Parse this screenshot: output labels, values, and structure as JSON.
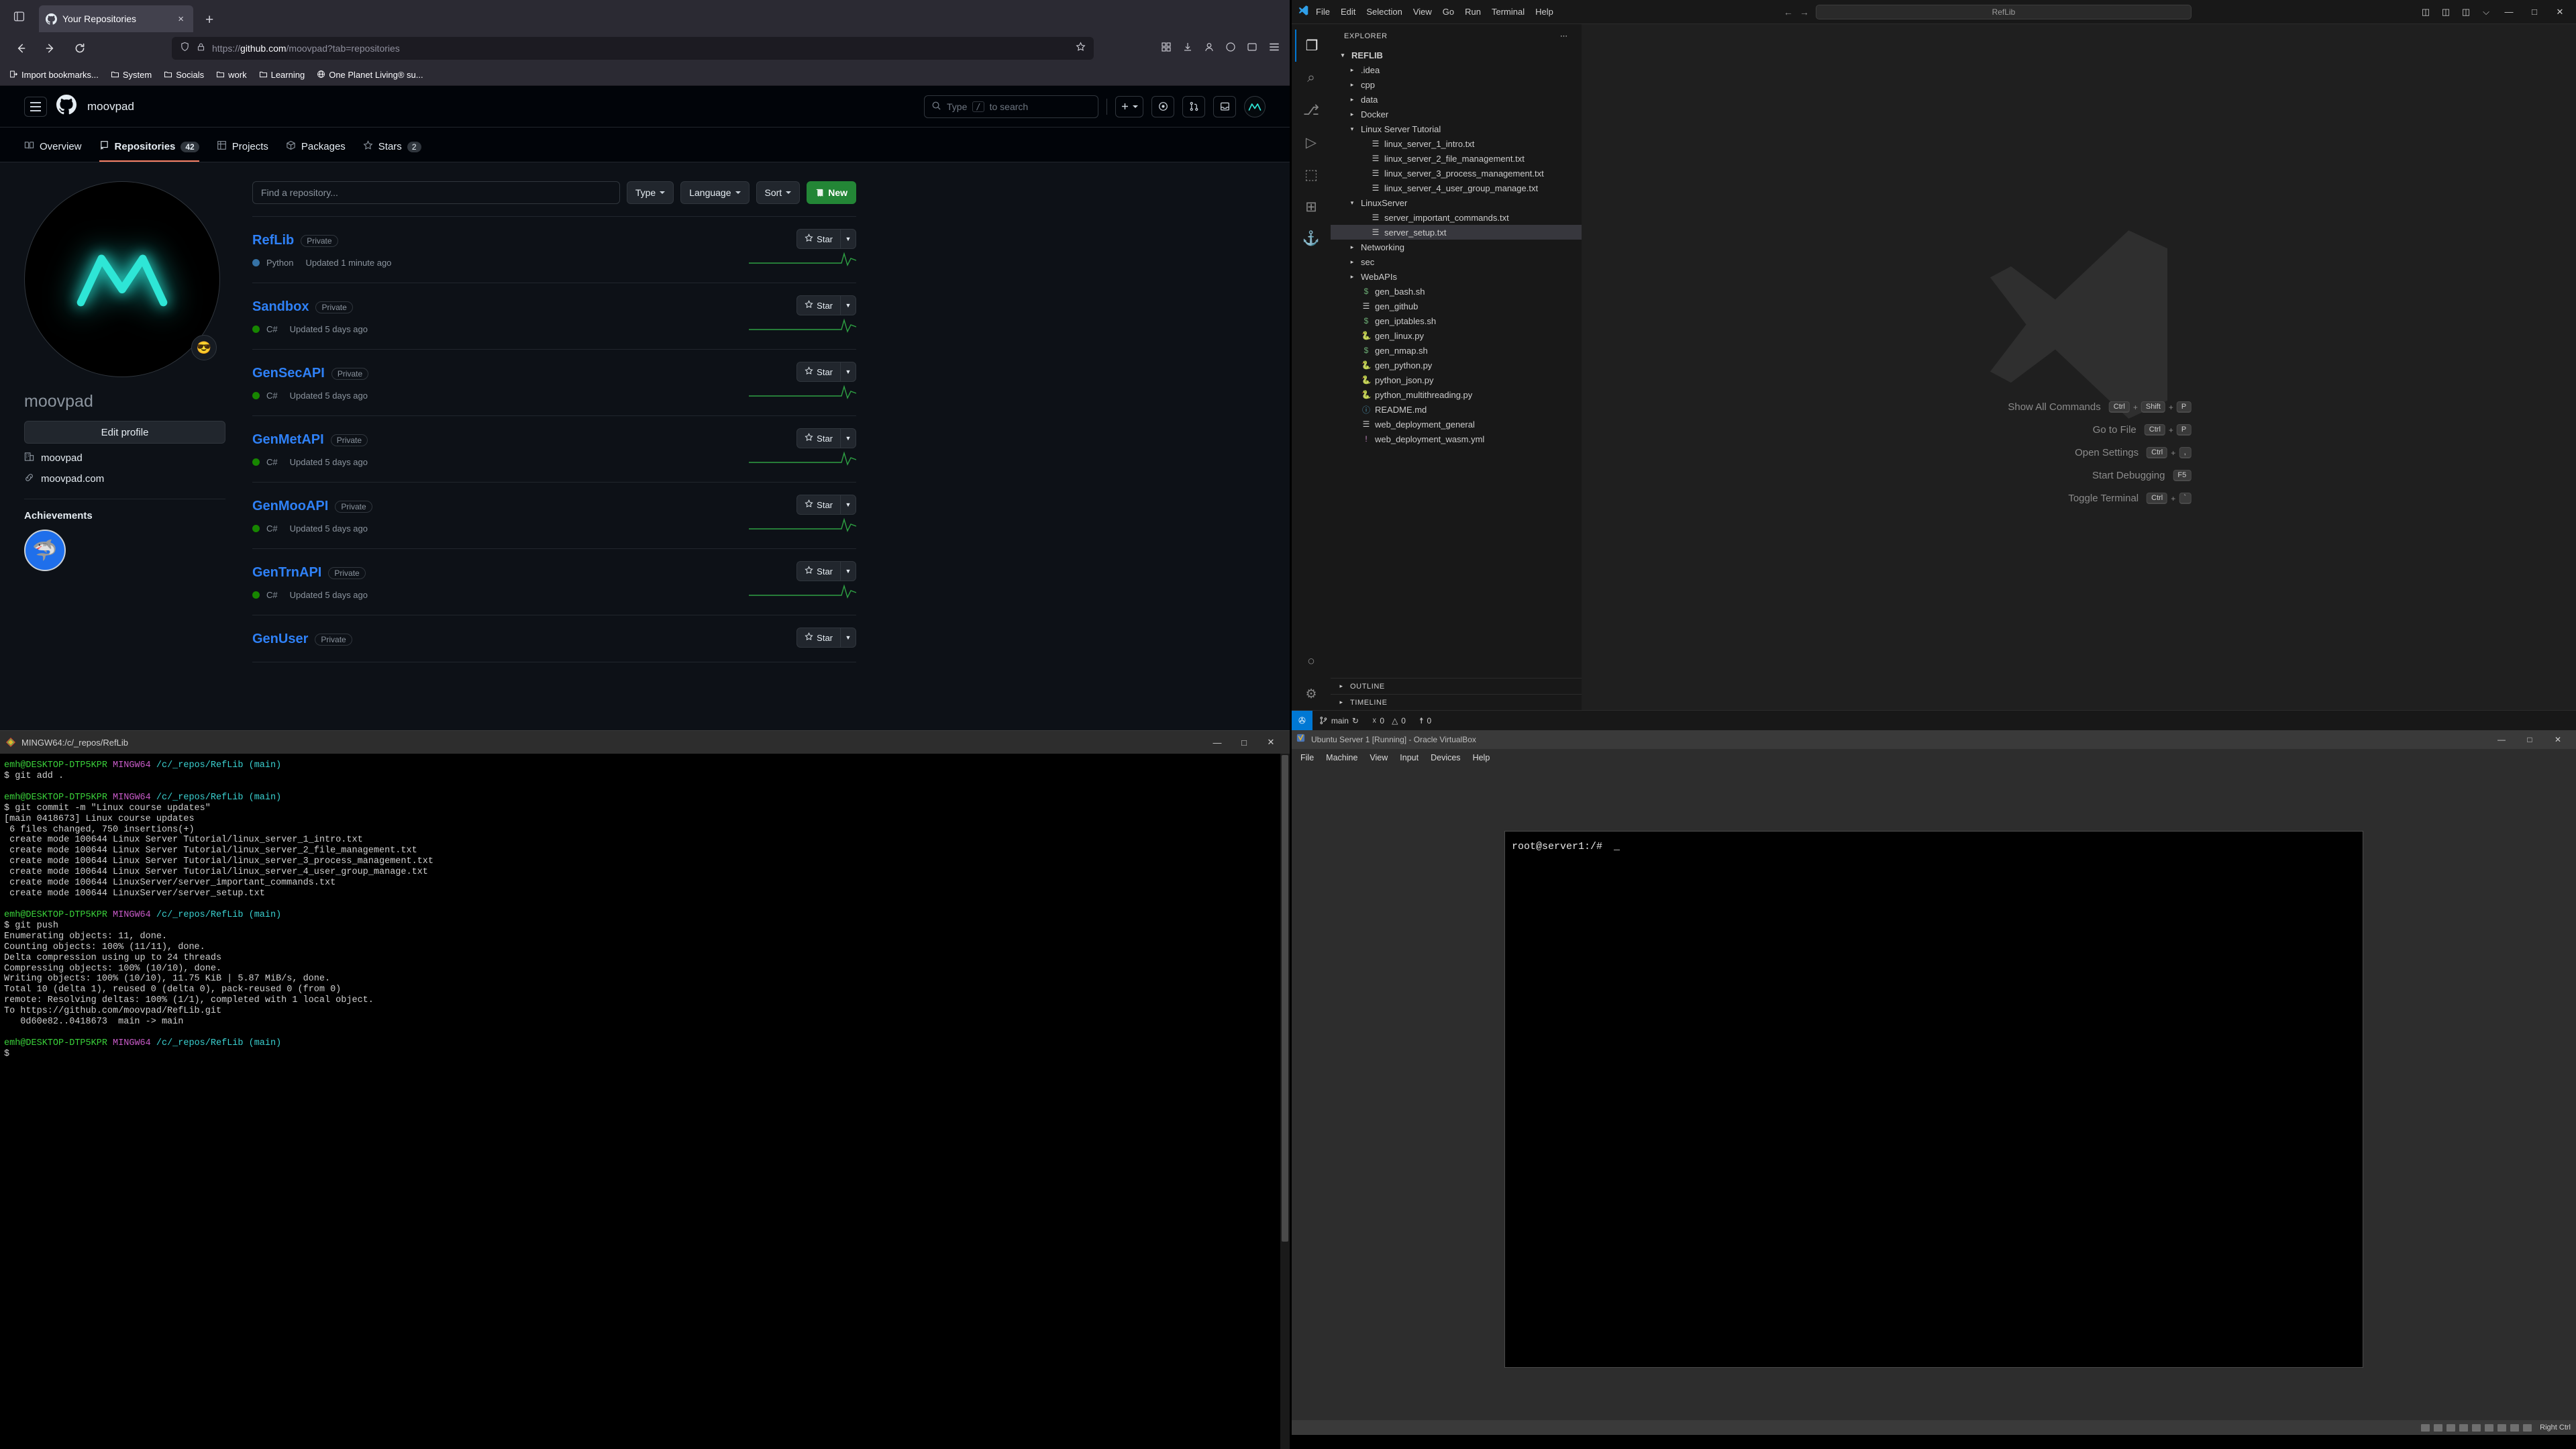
{
  "firefox": {
    "tab": {
      "title": "Your Repositories",
      "favicon": "github-icon"
    },
    "newtab_label": "+",
    "close_label": "×",
    "url": {
      "scheme": "https://",
      "domain": "github.com",
      "path": "/moovpad?tab=repositories"
    },
    "bookmarks": [
      {
        "label": "Import bookmarks...",
        "icon": "import-icon"
      },
      {
        "label": "System",
        "icon": "folder-icon"
      },
      {
        "label": "Socials",
        "icon": "folder-icon"
      },
      {
        "label": "work",
        "icon": "folder-icon"
      },
      {
        "label": "Learning",
        "icon": "folder-icon"
      },
      {
        "label": "One Planet Living® su...",
        "icon": "globe-icon"
      }
    ]
  },
  "github": {
    "owner": "moovpad",
    "search_placeholder": "Type",
    "search_kbd": "/",
    "search_suffix": "to search",
    "tabs": [
      {
        "label": "Overview",
        "icon": "book-icon",
        "count": null,
        "active": false
      },
      {
        "label": "Repositories",
        "icon": "repo-icon",
        "count": "42",
        "active": true
      },
      {
        "label": "Projects",
        "icon": "table-icon",
        "count": null,
        "active": false
      },
      {
        "label": "Packages",
        "icon": "package-icon",
        "count": null,
        "active": false
      },
      {
        "label": "Stars",
        "icon": "star-icon",
        "count": "2",
        "active": false
      }
    ],
    "sidebar": {
      "avatar_alt": "moovpad neon M logo",
      "status_emoji": "😎",
      "username": "moovpad",
      "edit_profile_label": "Edit profile",
      "org": "moovpad",
      "website": "moovpad.com",
      "achievements_title": "Achievements",
      "achievement_badge": "🦈"
    },
    "filters": {
      "find_placeholder": "Find a repository...",
      "type_label": "Type",
      "language_label": "Language",
      "sort_label": "Sort",
      "new_label": "New"
    },
    "star_label": "Star",
    "repos": [
      {
        "name": "RefLib",
        "visibility": "Private",
        "language": "Python",
        "lang_color": "#3572A5",
        "updated": "Updated 1 minute ago"
      },
      {
        "name": "Sandbox",
        "visibility": "Private",
        "language": "C#",
        "lang_color": "#178600",
        "updated": "Updated 5 days ago"
      },
      {
        "name": "GenSecAPI",
        "visibility": "Private",
        "language": "C#",
        "lang_color": "#178600",
        "updated": "Updated 5 days ago"
      },
      {
        "name": "GenMetAPI",
        "visibility": "Private",
        "language": "C#",
        "lang_color": "#178600",
        "updated": "Updated 5 days ago"
      },
      {
        "name": "GenMooAPI",
        "visibility": "Private",
        "language": "C#",
        "lang_color": "#178600",
        "updated": "Updated 5 days ago"
      },
      {
        "name": "GenTrnAPI",
        "visibility": "Private",
        "language": "C#",
        "lang_color": "#178600",
        "updated": "Updated 5 days ago"
      },
      {
        "name": "GenUser",
        "visibility": "Private",
        "language": "",
        "lang_color": "#178600",
        "updated": ""
      }
    ]
  },
  "gitbash": {
    "title": "MINGW64:/c/_repos/RefLib",
    "minimize": "—",
    "maximize": "□",
    "close": "✕",
    "prompt_user": "emh@DESKTOP-DTP5KPR",
    "prompt_host": "MINGW64",
    "prompt_path": "/c/_repos/RefLib",
    "prompt_branch": "(main)",
    "blocks": [
      {
        "command": "$ git add .",
        "output": []
      },
      {
        "command": "$ git commit -m \"Linux course updates\"",
        "output": [
          "[main 0418673] Linux course updates",
          " 6 files changed, 750 insertions(+)",
          " create mode 100644 Linux Server Tutorial/linux_server_1_intro.txt",
          " create mode 100644 Linux Server Tutorial/linux_server_2_file_management.txt",
          " create mode 100644 Linux Server Tutorial/linux_server_3_process_management.txt",
          " create mode 100644 Linux Server Tutorial/linux_server_4_user_group_manage.txt",
          " create mode 100644 LinuxServer/server_important_commands.txt",
          " create mode 100644 LinuxServer/server_setup.txt"
        ]
      },
      {
        "command": "$ git push",
        "output": [
          "Enumerating objects: 11, done.",
          "Counting objects: 100% (11/11), done.",
          "Delta compression using up to 24 threads",
          "Compressing objects: 100% (10/10), done.",
          "Writing objects: 100% (10/10), 11.75 KiB | 5.87 MiB/s, done.",
          "Total 10 (delta 1), reused 0 (delta 0), pack-reused 0 (from 0)",
          "remote: Resolving deltas: 100% (1/1), completed with 1 local object.",
          "To https://github.com/moovpad/RefLib.git",
          "   0d60e82..0418673  main -> main"
        ]
      },
      {
        "command": "$",
        "output": []
      }
    ]
  },
  "vscode": {
    "menus": [
      "File",
      "Edit",
      "Selection",
      "View",
      "Go",
      "Run",
      "Terminal",
      "Help"
    ],
    "quickinput_value": "RefLib",
    "window_buttons": [
      "—",
      "□",
      "✕"
    ],
    "activity_items": [
      {
        "name": "explorer-icon",
        "glyph": "❐",
        "active": true
      },
      {
        "name": "search-icon",
        "glyph": "⌕",
        "active": false
      },
      {
        "name": "source-control-icon",
        "glyph": "⎇",
        "active": false
      },
      {
        "name": "run-debug-icon",
        "glyph": "▷",
        "active": false
      },
      {
        "name": "remote-explorer-icon",
        "glyph": "⬚",
        "active": false
      },
      {
        "name": "extensions-icon",
        "glyph": "⊞",
        "active": false
      },
      {
        "name": "docker-icon",
        "glyph": "⚓",
        "active": false
      }
    ],
    "activity_bottom": [
      {
        "name": "accounts-icon",
        "glyph": "○"
      },
      {
        "name": "settings-gear-icon",
        "glyph": "⚙"
      }
    ],
    "explorer_title": "EXPLORER",
    "explorer_more": "⋯",
    "root": "REFLIB",
    "tree": [
      {
        "label": ".idea",
        "type": "folder",
        "open": false,
        "indent": 1,
        "icon": "chevron-right-icon"
      },
      {
        "label": "cpp",
        "type": "folder",
        "open": false,
        "indent": 1,
        "icon": "chevron-right-icon"
      },
      {
        "label": "data",
        "type": "folder",
        "open": false,
        "indent": 1,
        "icon": "chevron-right-icon"
      },
      {
        "label": "Docker",
        "type": "folder",
        "open": false,
        "indent": 1,
        "icon": "chevron-right-icon"
      },
      {
        "label": "Linux Server Tutorial",
        "type": "folder",
        "open": true,
        "indent": 1,
        "icon": "chevron-down-icon"
      },
      {
        "label": "linux_server_1_intro.txt",
        "type": "file",
        "indent": 2,
        "icon": "text-file-icon",
        "color": "#cccccc"
      },
      {
        "label": "linux_server_2_file_management.txt",
        "type": "file",
        "indent": 2,
        "icon": "text-file-icon",
        "color": "#cccccc"
      },
      {
        "label": "linux_server_3_process_management.txt",
        "type": "file",
        "indent": 2,
        "icon": "text-file-icon",
        "color": "#cccccc"
      },
      {
        "label": "linux_server_4_user_group_manage.txt",
        "type": "file",
        "indent": 2,
        "icon": "text-file-icon",
        "color": "#cccccc"
      },
      {
        "label": "LinuxServer",
        "type": "folder",
        "open": true,
        "indent": 1,
        "icon": "chevron-down-icon"
      },
      {
        "label": "server_important_commands.txt",
        "type": "file",
        "indent": 2,
        "icon": "text-file-icon",
        "color": "#cccccc"
      },
      {
        "label": "server_setup.txt",
        "type": "file",
        "indent": 2,
        "icon": "text-file-icon",
        "color": "#cccccc",
        "selected": true
      },
      {
        "label": "Networking",
        "type": "folder",
        "open": false,
        "indent": 1,
        "icon": "chevron-right-icon"
      },
      {
        "label": "sec",
        "type": "folder",
        "open": false,
        "indent": 1,
        "icon": "chevron-right-icon"
      },
      {
        "label": "WebAPIs",
        "type": "folder",
        "open": false,
        "indent": 1,
        "icon": "chevron-right-icon"
      },
      {
        "label": "gen_bash.sh",
        "type": "file",
        "indent": 1,
        "icon": "shell-file-icon",
        "glyph": "$",
        "color": "#6aab73"
      },
      {
        "label": "gen_github",
        "type": "file",
        "indent": 1,
        "icon": "text-file-icon",
        "color": "#cccccc"
      },
      {
        "label": "gen_iptables.sh",
        "type": "file",
        "indent": 1,
        "icon": "shell-file-icon",
        "glyph": "$",
        "color": "#6aab73"
      },
      {
        "label": "gen_linux.py",
        "type": "file",
        "indent": 1,
        "icon": "python-file-icon",
        "glyph": "🐍",
        "color": "#3f8fc4"
      },
      {
        "label": "gen_nmap.sh",
        "type": "file",
        "indent": 1,
        "icon": "shell-file-icon",
        "glyph": "$",
        "color": "#6aab73"
      },
      {
        "label": "gen_python.py",
        "type": "file",
        "indent": 1,
        "icon": "python-file-icon",
        "glyph": "🐍",
        "color": "#3f8fc4"
      },
      {
        "label": "python_json.py",
        "type": "file",
        "indent": 1,
        "icon": "python-file-icon",
        "glyph": "🐍",
        "color": "#3f8fc4"
      },
      {
        "label": "python_multithreading.py",
        "type": "file",
        "indent": 1,
        "icon": "python-file-icon",
        "glyph": "🐍",
        "color": "#3f8fc4"
      },
      {
        "label": "README.md",
        "type": "file",
        "indent": 1,
        "icon": "markdown-file-icon",
        "glyph": "ⓘ",
        "color": "#519aba"
      },
      {
        "label": "web_deployment_general",
        "type": "file",
        "indent": 1,
        "icon": "text-file-icon",
        "color": "#cccccc"
      },
      {
        "label": "web_deployment_wasm.yml",
        "type": "file",
        "indent": 1,
        "icon": "yaml-file-icon",
        "glyph": "!",
        "color": "#c586c0"
      }
    ],
    "bottom_sections": [
      {
        "label": "OUTLINE",
        "icon": "chevron-right-icon"
      },
      {
        "label": "TIMELINE",
        "icon": "chevron-right-icon"
      }
    ],
    "shortcuts": [
      {
        "label": "Show All Commands",
        "keys": [
          "Ctrl",
          "Shift",
          "P"
        ]
      },
      {
        "label": "Go to File",
        "keys": [
          "Ctrl",
          "P"
        ]
      },
      {
        "label": "Open Settings",
        "keys": [
          "Ctrl",
          ","
        ]
      },
      {
        "label": "Start Debugging",
        "keys": [
          "F5"
        ]
      },
      {
        "label": "Toggle Terminal",
        "keys": [
          "Ctrl",
          "`"
        ]
      }
    ],
    "status": {
      "remote_label": "✇",
      "branch": "main",
      "sync_icon": "sync-icon",
      "errors": "0",
      "warnings": "0",
      "ports": "0"
    }
  },
  "virtualbox": {
    "title": "Ubuntu Server 1 [Running] - Oracle VirtualBox",
    "window_buttons": [
      "—",
      "□",
      "✕"
    ],
    "menus": [
      "File",
      "Machine",
      "View",
      "Input",
      "Devices",
      "Help"
    ],
    "console_prompt": "root@server1:/#",
    "cursor": "_",
    "status_right_label": "Right Ctrl"
  }
}
